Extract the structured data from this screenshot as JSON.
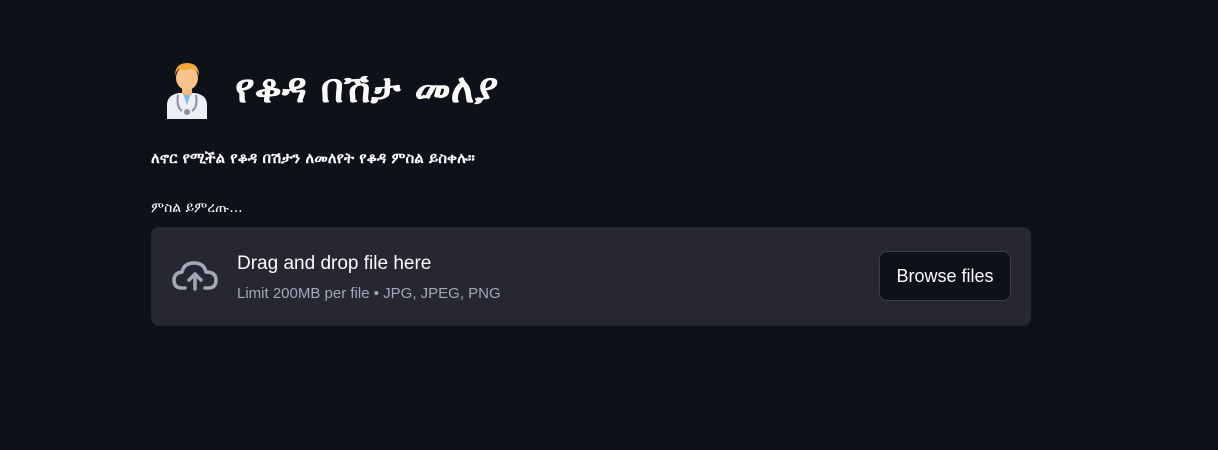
{
  "header": {
    "icon": "health-worker-emoji",
    "title": "የቆዳ በሽታ መለያ"
  },
  "subtitle": "ለኖር የሚችል የቆዳ በሽታን ለመለየት የቆዳ ምስል ይስቀሉ።",
  "uploader": {
    "label": "ምስል ይምረጡ...",
    "drag_text": "Drag and drop file here",
    "limit_text": "Limit 200MB per file • JPG, JPEG, PNG",
    "browse_label": "Browse files",
    "icon": "cloud-upload-icon"
  },
  "colors": {
    "background": "#0e1117",
    "dropzone": "#262730",
    "text": "#fafafa",
    "muted_text": "#a3a8b8"
  }
}
